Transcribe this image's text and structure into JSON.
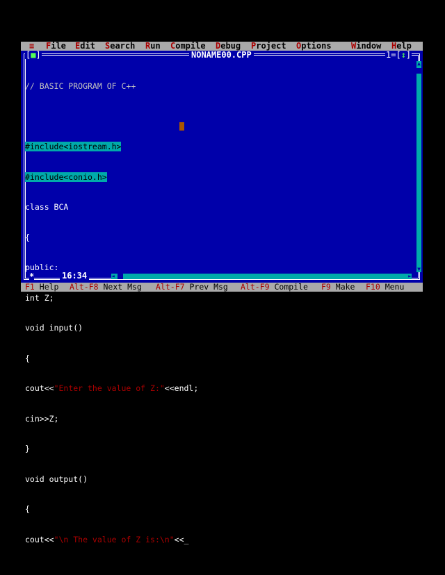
{
  "menubar": {
    "system": "≡",
    "items": [
      {
        "hot": "F",
        "rest": "ile"
      },
      {
        "hot": "E",
        "rest": "dit"
      },
      {
        "hot": "S",
        "rest": "earch"
      },
      {
        "hot": "R",
        "rest": "un"
      },
      {
        "hot": "C",
        "rest": "ompile"
      },
      {
        "hot": "D",
        "rest": "ebug"
      },
      {
        "hot": "P",
        "rest": "roject"
      },
      {
        "hot": "O",
        "rest": "ptions"
      },
      {
        "hot": "W",
        "rest": "indow"
      },
      {
        "hot": "H",
        "rest": "elp"
      }
    ]
  },
  "window": {
    "close_left": "[",
    "close_mark": "■",
    "close_right": "]",
    "title": "NONAME00.CPP",
    "number": "1",
    "zoom_left": "=[",
    "zoom_mark": "↕",
    "zoom_right": "]"
  },
  "code": {
    "l01": "// BASIC PROGRAM OF C++",
    "l02": "",
    "l03": "#include<iostream.h>",
    "l04": "#include<conio.h>",
    "l05": "class BCA",
    "l06": "{",
    "l07": "public:",
    "l08": "int Z;",
    "l09": "void input()",
    "l10": "{",
    "l11a": "cout<<",
    "l11b": "\"Enter the value of Z:\"",
    "l11c": "<<endl;",
    "l12": "cin>>Z;",
    "l13": "}",
    "l14": "void output()",
    "l15": "{",
    "l16a": "cout<<",
    "l16b": "\"\\n The value of Z is:\\n\"",
    "l16c": "<<_"
  },
  "status": {
    "modified": "*",
    "position": "16:34"
  },
  "fkeys": [
    {
      "key": "F1",
      "label": " Help"
    },
    {
      "key": "Alt-F8",
      "label": " Next Msg"
    },
    {
      "key": "Alt-F7",
      "label": " Prev Msg"
    },
    {
      "key": "Alt-F9",
      "label": " Compile"
    },
    {
      "key": "F9",
      "label": " Make"
    },
    {
      "key": "F10",
      "label": " Menu"
    }
  ],
  "colors": {
    "background": "#0000aa",
    "menu": "#aaaaaa",
    "hotkey": "#aa0000",
    "highlight": "#00aaaa",
    "cursor": "#aa5500"
  }
}
